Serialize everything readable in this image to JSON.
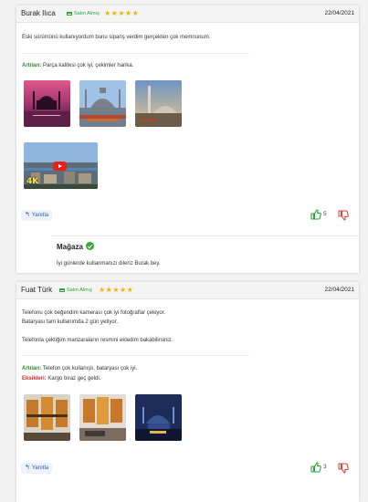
{
  "reviews": [
    {
      "author": "Burak Ilıca",
      "verified_label": "Satın Almış",
      "stars": "★★★★★",
      "rating": 5,
      "date": "22/04/2021",
      "body_lines": [
        "Eski sürümünü kullanıyordum bunu sipariş verdim gerçekten çok memnunum."
      ],
      "pros_label": "Artıları:",
      "pros_text": "Parça kalitesi çok iyi, çekimler harika.",
      "attachments": [
        {
          "icon": "photo-istanbul-sunset-mosque"
        },
        {
          "icon": "photo-mosque-bosphorus"
        },
        {
          "icon": "photo-mosque-minaret"
        },
        {
          "icon": "video-istanbul-4k"
        }
      ],
      "video_badge": "4K",
      "reply_label": "Yanıtla",
      "likes": "5",
      "store_reply": {
        "name": "Mağaza",
        "text": "İyi günlerde kullanmanızı dileriz Burak bey."
      }
    },
    {
      "author": "Fuat Türk",
      "verified_label": "Satın Almış",
      "stars": "★★★★★",
      "rating": 5,
      "date": "22/04/2021",
      "body_lines": [
        "Telefonu çok beğendim kamerası çok iyi fotoğraflar çekiyor.",
        "Bataryası tam kullanımda 2 gün yetiyor.",
        "Telefonla çektiğim manzaraların resmini ekledim bakabilirsiniz."
      ],
      "pros_label": "Artıları:",
      "pros_text": "Telefon çok kullanışlı, bataryası çok iyi.",
      "cons_label": "Eksikleri:",
      "cons_text": "Kargo biraz geç geldi.",
      "attachments": [
        {
          "icon": "photo-wall-art-sunset"
        },
        {
          "icon": "photo-wall-art-sunset-room"
        },
        {
          "icon": "photo-night-mosque"
        }
      ],
      "reply_label": "Yanıtla",
      "likes": "3"
    }
  ],
  "colors": {
    "star": "#f0b400",
    "verified": "#2ea63a",
    "like": "#2ea63a",
    "dislike": "#e0433a",
    "pros": "#2e8b2e",
    "cons": "#d62a2a"
  }
}
